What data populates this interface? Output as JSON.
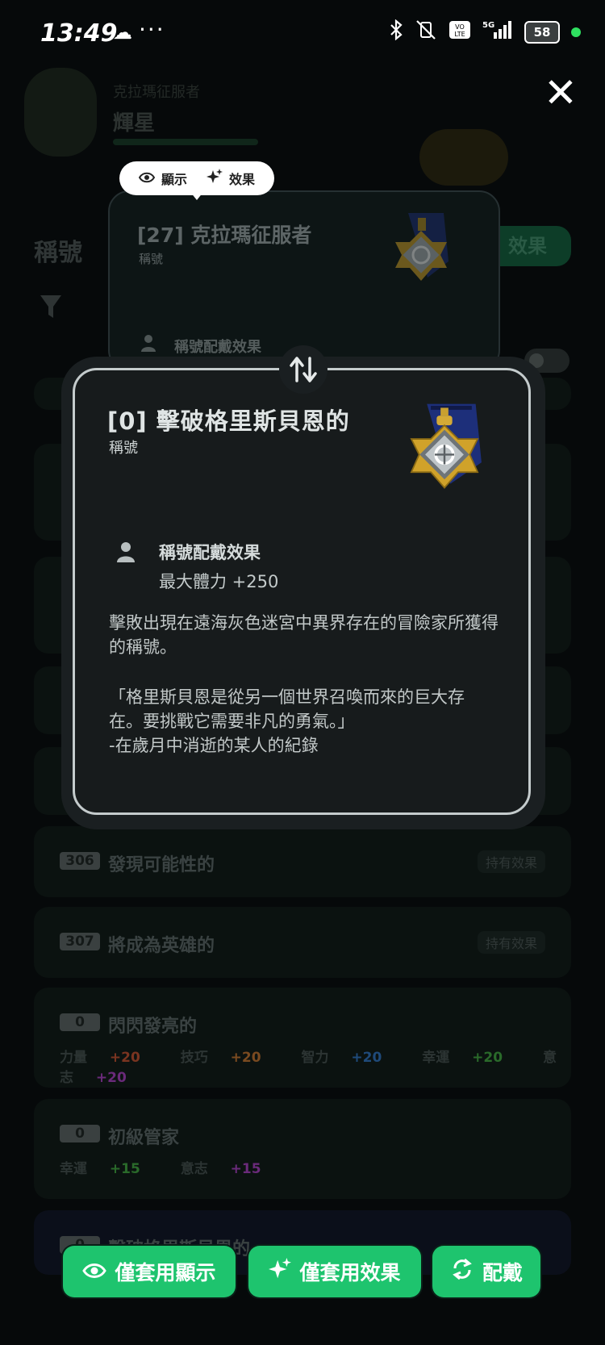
{
  "status_bar": {
    "time": "13:49",
    "battery": "58",
    "network": "5G"
  },
  "background": {
    "header_sub": "克拉瑪征服者",
    "header_name": "輝星",
    "section_title": "稱號",
    "effect_button": "效果",
    "rows": [
      {
        "num": "306",
        "name": "發現可能性的",
        "tag": "持有效果"
      },
      {
        "num": "307",
        "name": "將成為英雄的",
        "tag": "持有效果"
      },
      {
        "num": "0",
        "name": "閃閃發亮的",
        "stats": [
          {
            "label": "力量",
            "value": "+20",
            "color": "#9a3a1e"
          },
          {
            "label": "技巧",
            "value": "+20",
            "color": "#9a5a1e"
          },
          {
            "label": "智力",
            "value": "+20",
            "color": "#1e5a9a"
          },
          {
            "label": "幸運",
            "value": "+20",
            "color": "#2e7a2e"
          },
          {
            "label": "意志",
            "value": "+20",
            "color": "#7a2e8a"
          }
        ]
      },
      {
        "num": "0",
        "name": "初級管家",
        "stats": [
          {
            "label": "幸運",
            "value": "+15",
            "color": "#2e7a2e"
          },
          {
            "label": "意志",
            "value": "+15",
            "color": "#7a2e8a"
          }
        ]
      },
      {
        "num": "0",
        "name": "擊破格里斯貝恩的"
      }
    ]
  },
  "compare_pill": {
    "display_label": "顯示",
    "effect_label": "效果"
  },
  "top_card": {
    "title": "[27] 克拉瑪征服者",
    "type": "稱號",
    "effect_label": "稱號配戴效果"
  },
  "main_card": {
    "title": "[0] 擊破格里斯貝恩的",
    "type": "稱號",
    "effect_label": "稱號配戴效果",
    "effect_value": "最大體力 +250",
    "description": "擊敗出現在遠海灰色迷宮中異界存在的冒險家所獲得的稱號。",
    "quote_lines": [
      "「格里斯貝恩是從另一個世界召喚而來的巨大存",
      "在。要挑戰它需要非凡的勇氣。」",
      "-在歲月中消逝的某人的紀錄"
    ]
  },
  "buttons": {
    "apply_display": "僅套用顯示",
    "apply_effect": "僅套用效果",
    "equip": "配戴"
  },
  "colors": {
    "accent_green": "#1ec46e"
  }
}
